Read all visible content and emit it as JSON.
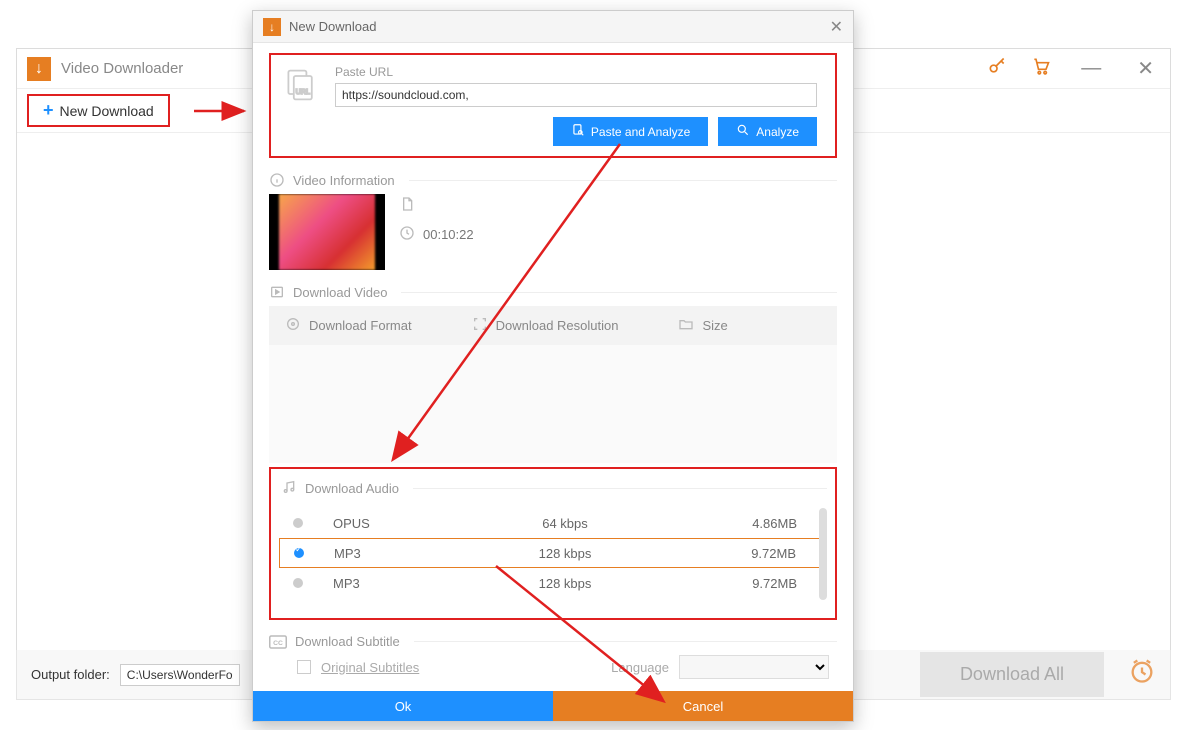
{
  "main": {
    "app_title": "Video Downloader",
    "new_download_label": "New Download",
    "output_folder_label": "Output folder:",
    "output_folder_value": "C:\\Users\\WonderFox\\",
    "download_all_label": "Download All"
  },
  "dialog": {
    "title": "New Download",
    "paste_url_label": "Paste URL",
    "url_value": "https://soundcloud.com,",
    "paste_analyze_label": "Paste and Analyze",
    "analyze_label": "Analyze",
    "video_info_label": "Video Information",
    "duration": "00:10:22",
    "download_video_label": "Download Video",
    "col_format": "Download Format",
    "col_resolution": "Download Resolution",
    "col_size": "Size",
    "download_audio_label": "Download Audio",
    "audio_rows": [
      {
        "format": "OPUS",
        "bitrate": "64 kbps",
        "size": "4.86MB",
        "selected": false
      },
      {
        "format": "MP3",
        "bitrate": "128 kbps",
        "size": "9.72MB",
        "selected": true
      },
      {
        "format": "MP3",
        "bitrate": "128 kbps",
        "size": "9.72MB",
        "selected": false
      }
    ],
    "download_subtitle_label": "Download Subtitle",
    "original_subtitles_label": "Original Subtitles",
    "language_label": "Language",
    "ok_label": "Ok",
    "cancel_label": "Cancel"
  }
}
